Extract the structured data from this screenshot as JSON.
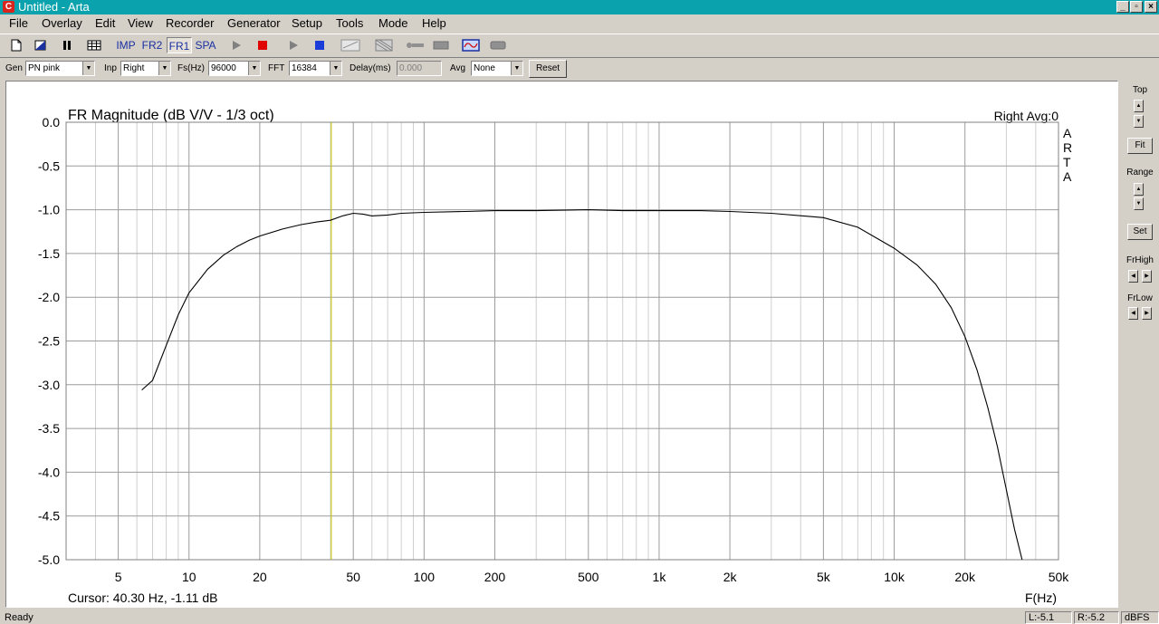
{
  "window": {
    "title": "Untitled - Arta",
    "app_icon": "C"
  },
  "menu": [
    "File",
    "Overlay",
    "Edit",
    "View",
    "Recorder",
    "Generator",
    "Setup",
    "Tools",
    "Mode",
    "Help"
  ],
  "toolbar": {
    "modes": [
      "IMP",
      "FR2",
      "FR1",
      "SPA"
    ],
    "active_mode": "FR1"
  },
  "controls": {
    "gen_label": "Gen",
    "gen_value": "PN pink",
    "inp_label": "Inp",
    "inp_value": "Right",
    "fs_label": "Fs(Hz)",
    "fs_value": "96000",
    "fft_label": "FFT",
    "fft_value": "16384",
    "delay_label": "Delay(ms)",
    "delay_value": "0.000",
    "avg_label": "Avg",
    "avg_value": "None",
    "reset_label": "Reset"
  },
  "plot": {
    "title": "FR Magnitude (dB V/V - 1/3 oct)",
    "channel_info": "Right  Avg:0",
    "watermark": [
      "A",
      "R",
      "T",
      "A"
    ],
    "cursor_text": "Cursor: 40.30 Hz, -1.11 dB",
    "xlabel": "F(Hz)"
  },
  "chart_data": {
    "type": "line",
    "title": "FR Magnitude (dB V/V - 1/3 oct)",
    "xlabel": "F(Hz)",
    "ylabel": "",
    "x_scale": "log",
    "xlim": [
      3,
      50000
    ],
    "ylim": [
      -5.0,
      0.0
    ],
    "grid": true,
    "x_tick_labels": [
      "5",
      "10",
      "20",
      "50",
      "100",
      "200",
      "500",
      "1k",
      "2k",
      "5k",
      "10k",
      "20k",
      "50k"
    ],
    "x_tick_values": [
      5,
      10,
      20,
      50,
      100,
      200,
      500,
      1000,
      2000,
      5000,
      10000,
      20000,
      50000
    ],
    "y_tick_labels": [
      "0.0",
      "-0.5",
      "-1.0",
      "-1.5",
      "-2.0",
      "-2.5",
      "-3.0",
      "-3.5",
      "-4.0",
      "-4.5",
      "-5.0"
    ],
    "y_tick_values": [
      0,
      -0.5,
      -1.0,
      -1.5,
      -2.0,
      -2.5,
      -3.0,
      -3.5,
      -4.0,
      -4.5,
      -5.0
    ],
    "cursor_x": 40.3,
    "series": [
      {
        "x": [
          6.3,
          7,
          8,
          9,
          10,
          12,
          14,
          16,
          18,
          20,
          25,
          30,
          35,
          40,
          45,
          50,
          55,
          60,
          70,
          80,
          100,
          150,
          200,
          300,
          500,
          700,
          1000,
          1500,
          2000,
          3000,
          5000,
          7000,
          10000,
          12500,
          15000,
          17500,
          20000,
          22500,
          25000,
          27500,
          30000,
          32500,
          35000
        ],
        "y": [
          -3.06,
          -2.95,
          -2.55,
          -2.2,
          -1.95,
          -1.68,
          -1.52,
          -1.42,
          -1.35,
          -1.3,
          -1.22,
          -1.17,
          -1.14,
          -1.12,
          -1.07,
          -1.04,
          -1.05,
          -1.07,
          -1.06,
          -1.04,
          -1.03,
          -1.02,
          -1.01,
          -1.01,
          -1.0,
          -1.01,
          -1.01,
          -1.01,
          -1.02,
          -1.04,
          -1.09,
          -1.2,
          -1.44,
          -1.63,
          -1.85,
          -2.12,
          -2.45,
          -2.83,
          -3.26,
          -3.71,
          -4.2,
          -4.65,
          -5.0
        ]
      }
    ]
  },
  "right_panel": {
    "top_label": "Top",
    "fit_label": "Fit",
    "range_label": "Range",
    "set_label": "Set",
    "frhigh_label": "FrHigh",
    "frlow_label": "FrLow"
  },
  "status": {
    "text": "Ready",
    "left_level": "L:-5.1",
    "right_level": "R:-5.2",
    "units": "dBFS"
  },
  "colors": {
    "titlebar": "#0aa3ad",
    "cursor": "#c8c800",
    "curve": "#000000",
    "stop_red": "#e00000",
    "play_blue": "#1a3cd8"
  }
}
